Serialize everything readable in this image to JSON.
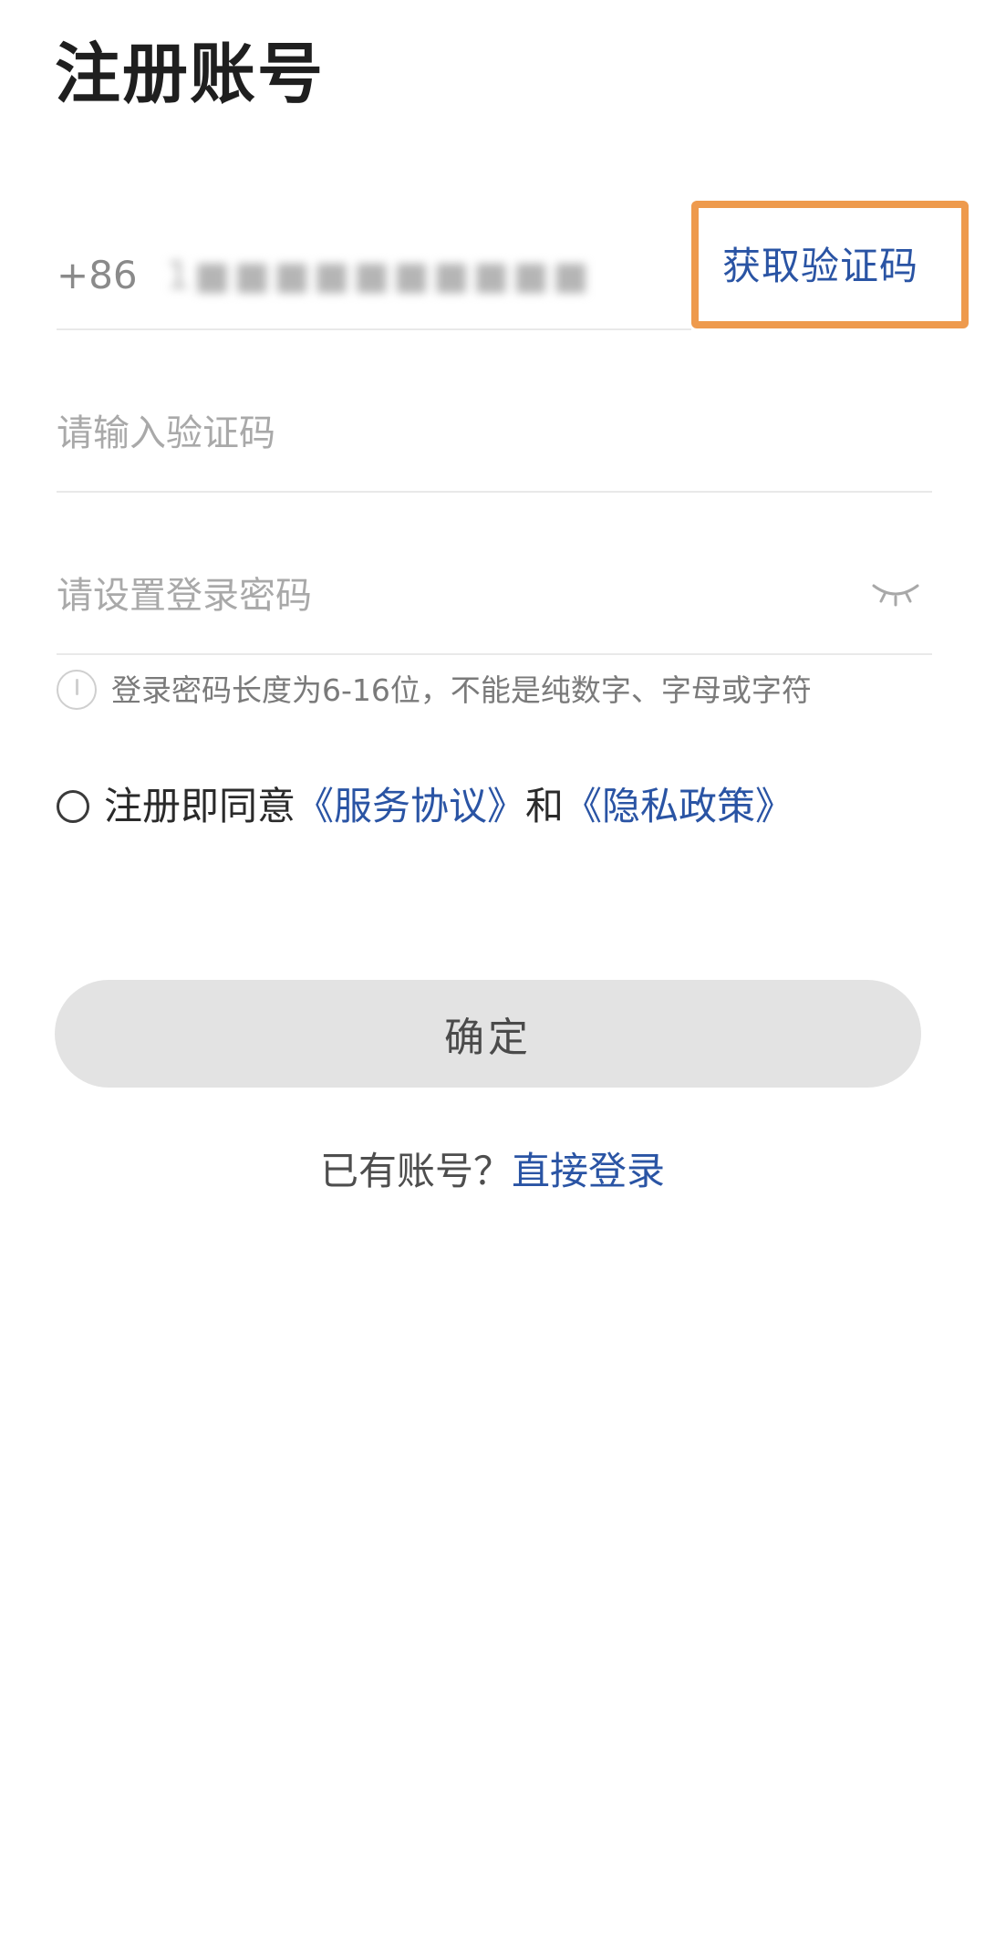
{
  "header": {
    "title": "注册账号"
  },
  "phone": {
    "country_code": "+86",
    "number": "1■■■■■■■■■■",
    "get_code_label": "获取验证码"
  },
  "verification_code": {
    "placeholder": "请输入验证码",
    "value": ""
  },
  "password": {
    "placeholder": "请设置登录密码",
    "value": "",
    "toggle_icon": "eye-closed-icon",
    "hint": "登录密码长度为6-16位，不能是纯数字、字母或字符"
  },
  "agreement": {
    "checked": false,
    "prefix": "注册即同意",
    "service_link": "《服务协议》",
    "conjunction": "和",
    "privacy_link": "《隐私政策》"
  },
  "actions": {
    "confirm_label": "确定"
  },
  "login": {
    "question": "已有账号？",
    "link": "直接登录"
  },
  "colors": {
    "link": "#2a54a4",
    "highlight_border": "#ee9a4d",
    "button_bg": "#e3e3e3"
  }
}
